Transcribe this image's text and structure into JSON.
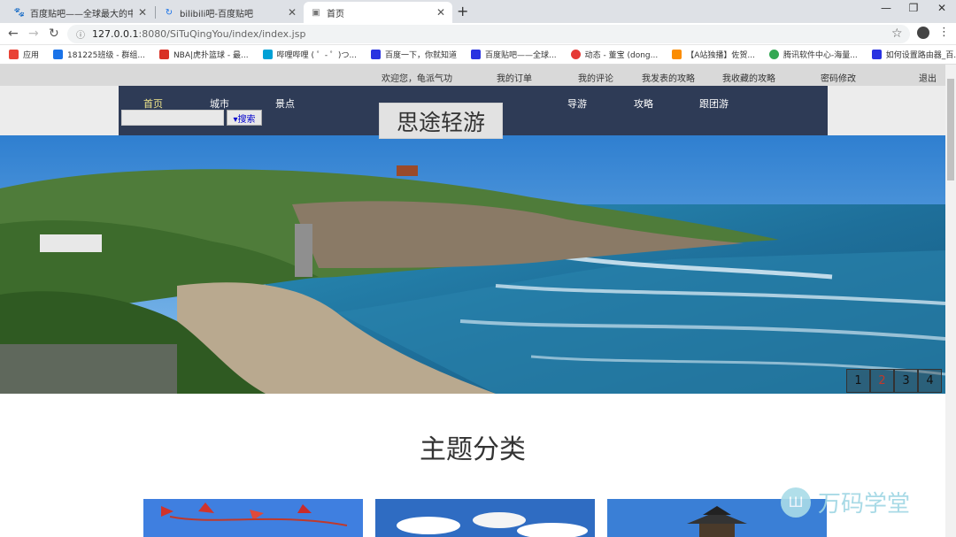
{
  "browser": {
    "tabs": [
      {
        "title": "百度贴吧——全球最大的中文社区",
        "icon": "baidu-paw-icon"
      },
      {
        "title": "bilibili吧-百度贴吧",
        "icon": "loading-icon"
      },
      {
        "title": "首页",
        "icon": "page-icon"
      }
    ],
    "new_tab": "+",
    "minimize": "—",
    "maximize": "❐",
    "close": "✕",
    "url_host": "127.0.0.1",
    "url_path": ":8080/SiTuQingYou/index/index.jsp",
    "bookmarks": [
      {
        "label": "应用",
        "color": "#e94235"
      },
      {
        "label": "181225班级 - 群组...",
        "color": "#1a73e8"
      },
      {
        "label": "NBA|虎扑篮球 - 最...",
        "color": "#d93025"
      },
      {
        "label": "哔哩哔哩 ( ゜- ゜)つ...",
        "color": "#00a1d6"
      },
      {
        "label": "百度一下，你就知道",
        "color": "#2932e1"
      },
      {
        "label": "百度贴吧——全球...",
        "color": "#2932e1"
      },
      {
        "label": "动态 - 董宝 (dong...",
        "color": "#e53935"
      },
      {
        "label": "【A站独播】佐贺...",
        "color": "#fb8c00"
      },
      {
        "label": "腾讯软件中心-海量...",
        "color": "#34a853"
      },
      {
        "label": "如何设置路由器_百...",
        "color": "#2932e1"
      }
    ]
  },
  "topstrip": {
    "welcome": "欢迎您，龟派气功",
    "links": [
      "我的订单",
      "我的评论",
      "我发表的攻略",
      "我收藏的攻略",
      "密码修改"
    ],
    "logout": "退出"
  },
  "nav": {
    "items": [
      "首页",
      "城市",
      "景点",
      "导游",
      "攻略",
      "跟团游"
    ],
    "search_button": "▾搜索",
    "search_placeholder": ""
  },
  "logo_text": "思途轻游",
  "carousel": {
    "pages": [
      "1",
      "2",
      "3",
      "4"
    ],
    "active_page": "2"
  },
  "section_title": "主题分类",
  "watermark": "万码学堂"
}
